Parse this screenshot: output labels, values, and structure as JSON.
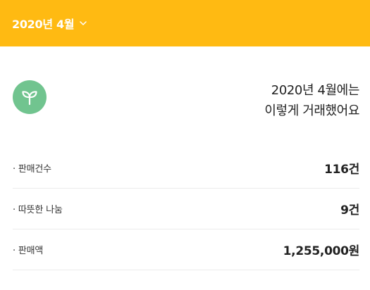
{
  "colors": {
    "header_bg": "#FFBA12",
    "header_text": "#FFFFFF",
    "leaf_badge_bg": "#71C48F",
    "divider": "#ECECEC"
  },
  "header": {
    "month_label": "2020년 4월",
    "dropdown_icon": "chevron-down-icon"
  },
  "summary": {
    "icon": "leaf-sprout-icon",
    "title_line1": "2020년 4월에는",
    "title_line2": "이렇게 거래했어요"
  },
  "stats": [
    {
      "label": "· 판매건수",
      "value": "116건"
    },
    {
      "label": "· 따뜻한 나눔",
      "value": "9건"
    },
    {
      "label": "· 판매액",
      "value": "1,255,000원"
    }
  ]
}
